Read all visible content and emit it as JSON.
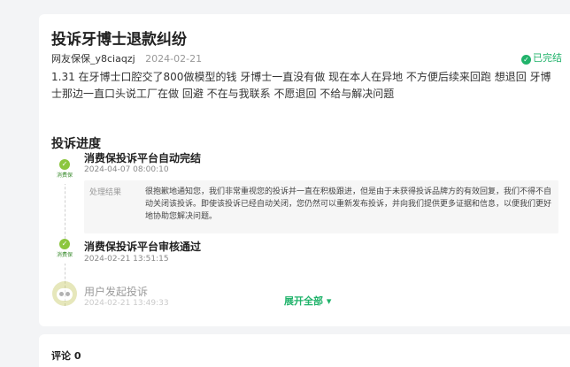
{
  "complaint": {
    "title": "投诉牙博士退款纠纷",
    "user": "网友保保_y8ciaqzj",
    "date": "2024-02-21",
    "status": "已完结",
    "content": "1.31 在牙博士口腔交了800做模型的钱 牙博士一直没有做 现在本人在异地 不方便后续来回跑 想退回 牙博士那边一直口头说工厂在做 回避 不在与我联系 不愿退回 不给与解决问题"
  },
  "progress": {
    "title": "投诉进度",
    "logo_label": "消费保",
    "items": [
      {
        "title": "消费保投诉平台自动完结",
        "time": "2024-04-07 08:00:10",
        "result_label": "处理结果",
        "result_text": "很抱歉地通知您，我们非常重视您的投诉并一直在积极跟进，但是由于未获得投诉品牌方的有效回复，我们不得不自动关闭该投诉。即使该投诉已经自动关闭，您仍然可以重新发布投诉，并向我们提供更多证据和信息，以便我们更好地协助您解决问题。"
      },
      {
        "title": "消费保投诉平台审核通过",
        "time": "2024-02-21 13:51:15"
      },
      {
        "title": "用户发起投诉",
        "time": "2024-02-21 13:49:33"
      }
    ],
    "expand_label": "展开全部 ▾"
  },
  "comments": {
    "title": "评论 0"
  },
  "colors": {
    "accent": "#21b36b",
    "background": "#f3f4f6"
  }
}
